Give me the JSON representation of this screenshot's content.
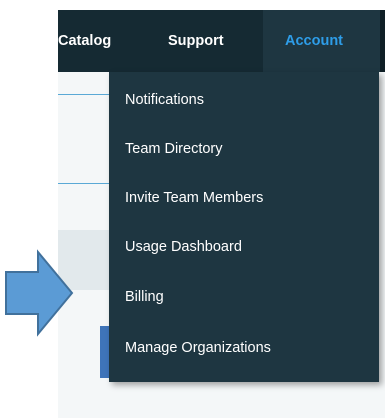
{
  "nav": {
    "items": [
      {
        "label": "Catalog"
      },
      {
        "label": "Support"
      },
      {
        "label": "Account"
      }
    ],
    "active_color": "#2e9de8",
    "bar_color": "#152a33"
  },
  "dropdown": {
    "items": [
      {
        "label": "Notifications"
      },
      {
        "label": "Team Directory"
      },
      {
        "label": "Invite Team Members"
      },
      {
        "label": "Usage Dashboard"
      },
      {
        "label": "Billing"
      },
      {
        "label": "Manage Organizations"
      }
    ],
    "background": "#1e3641"
  },
  "annotation": {
    "icon": "right-arrow-icon",
    "color": "#5b9bd5"
  }
}
